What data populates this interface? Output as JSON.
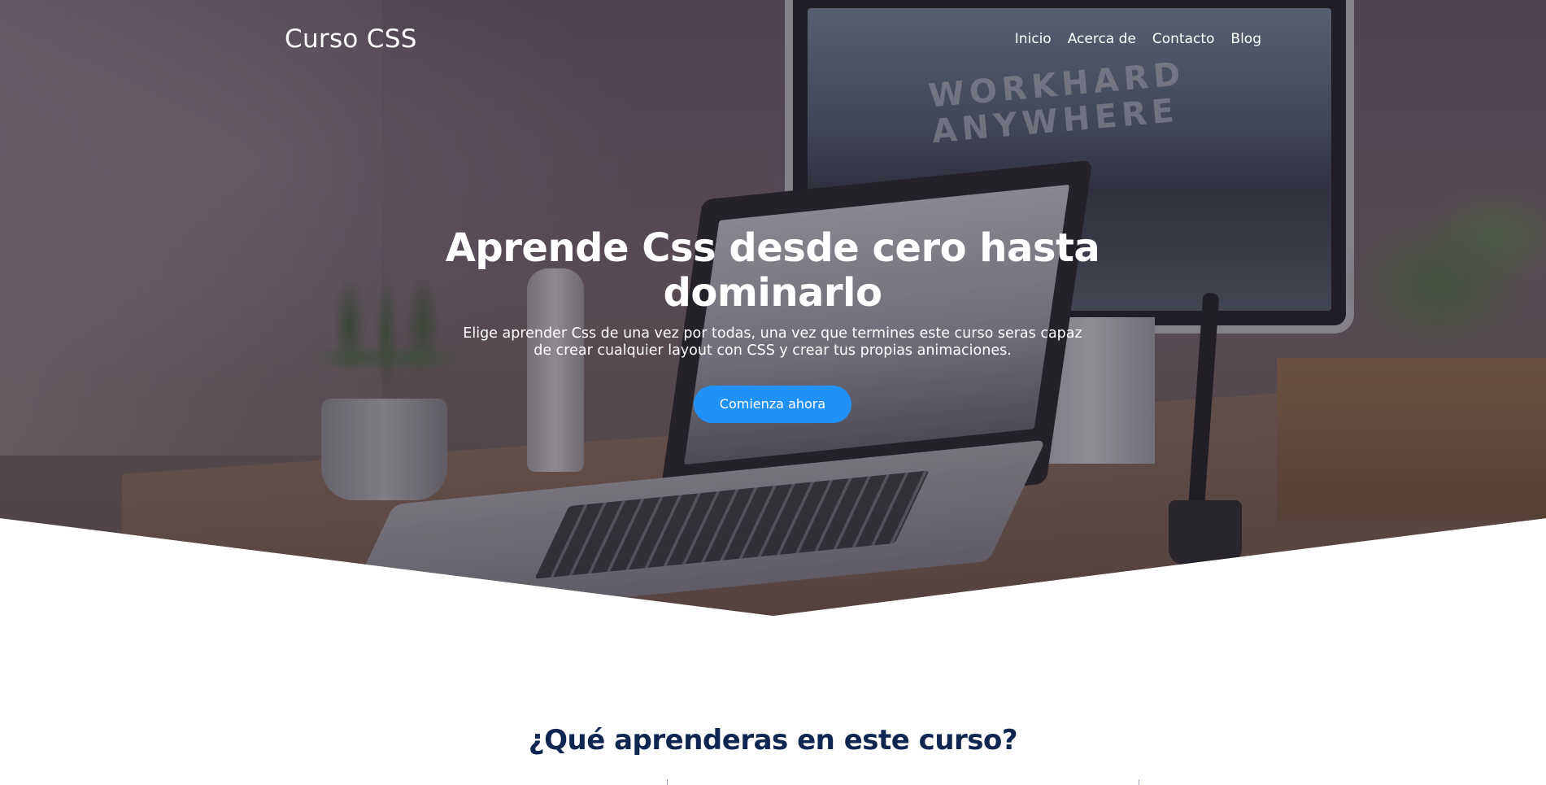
{
  "nav": {
    "brand": "Curso CSS",
    "items": [
      {
        "label": "Inicio"
      },
      {
        "label": "Acerca de"
      },
      {
        "label": "Contacto"
      },
      {
        "label": "Blog"
      }
    ]
  },
  "hero": {
    "title": "Aprende Css desde cero hasta dominarlo",
    "subtitle": "Elige aprender Css de una vez por todas, una vez que termines este curso seras capaz de crear cualquier layout con CSS y crear tus propias animaciones.",
    "cta_label": "Comienza ahora",
    "background_art_text": "WORKHARD ANYWHERE"
  },
  "section": {
    "title": "¿Qué aprenderas en este curso?"
  },
  "colors": {
    "accent": "#2091f9",
    "heading": "#0f2650",
    "overlay": "#281e2d"
  }
}
